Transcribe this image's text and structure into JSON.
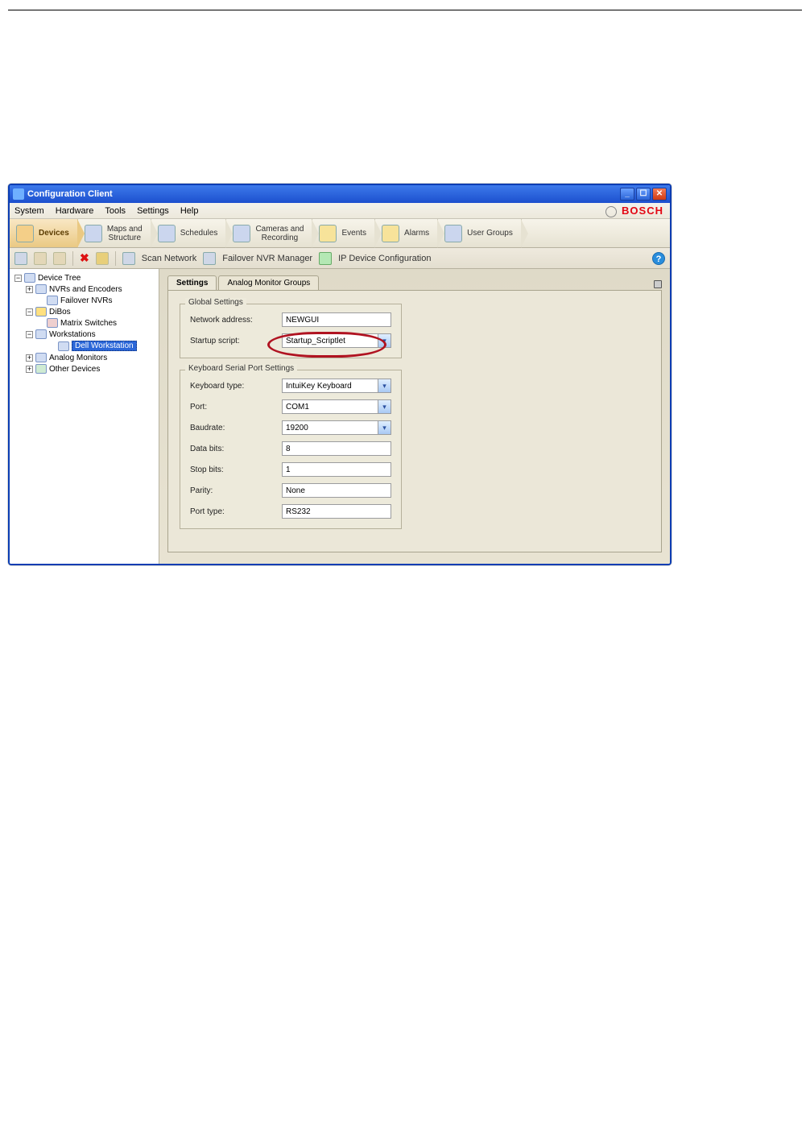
{
  "window": {
    "title": "Configuration Client"
  },
  "menu": {
    "items": [
      "System",
      "Hardware",
      "Tools",
      "Settings",
      "Help"
    ],
    "brand": "BOSCH"
  },
  "nav": {
    "items": [
      {
        "label": "Devices",
        "active": true
      },
      {
        "label": "Maps and\nStructure"
      },
      {
        "label": "Schedules"
      },
      {
        "label": "Cameras and\nRecording"
      },
      {
        "label": "Events"
      },
      {
        "label": "Alarms"
      },
      {
        "label": "User Groups"
      }
    ]
  },
  "toolbar": {
    "scan_network": "Scan Network",
    "failover_mgr": "Failover NVR Manager",
    "ip_config": "IP Device Configuration"
  },
  "tree": {
    "root": "Device Tree",
    "items": [
      {
        "label": "NVRs and Encoders",
        "level": 2,
        "exp": "+"
      },
      {
        "label": "Failover NVRs",
        "level": 3,
        "exp": ""
      },
      {
        "label": "DiBos",
        "level": 2,
        "exp": "−"
      },
      {
        "label": "Matrix Switches",
        "level": 3,
        "exp": ""
      },
      {
        "label": "Workstations",
        "level": 2,
        "exp": "−"
      },
      {
        "label": "Dell Workstation",
        "level": 4,
        "exp": "",
        "sel": true
      },
      {
        "label": "Analog Monitors",
        "level": 2,
        "exp": "+"
      },
      {
        "label": "Other Devices",
        "level": 2,
        "exp": "+"
      }
    ]
  },
  "tabs": {
    "settings": "Settings",
    "amg": "Analog Monitor Groups"
  },
  "global": {
    "legend": "Global Settings",
    "network_label": "Network address:",
    "network_value": "NEWGUI",
    "startup_label": "Startup script:",
    "startup_value": "Startup_Scriptlet"
  },
  "serial": {
    "legend": "Keyboard Serial Port Settings",
    "kbtype_label": "Keyboard type:",
    "kbtype_value": "IntuiKey Keyboard",
    "port_label": "Port:",
    "port_value": "COM1",
    "baud_label": "Baudrate:",
    "baud_value": "19200",
    "data_label": "Data bits:",
    "data_value": "8",
    "stop_label": "Stop bits:",
    "stop_value": "1",
    "parity_label": "Parity:",
    "parity_value": "None",
    "ptype_label": "Port type:",
    "ptype_value": "RS232"
  }
}
